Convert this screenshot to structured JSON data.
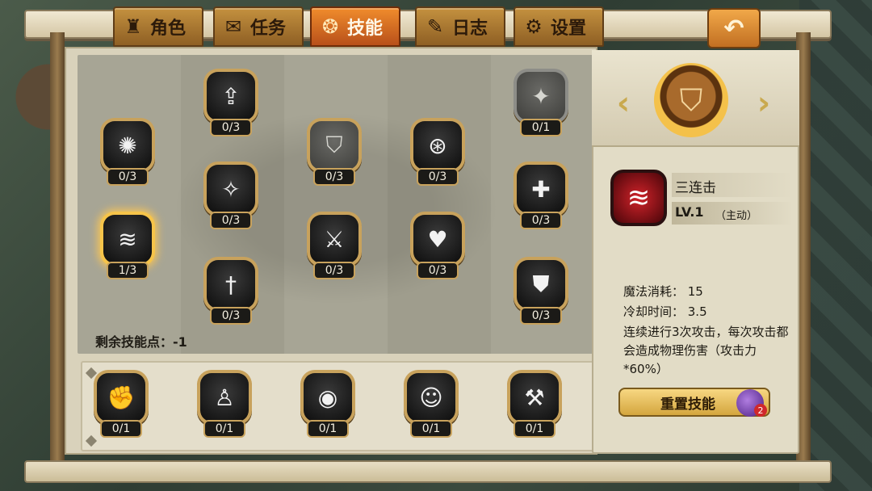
{
  "tabs": [
    {
      "label": "角色",
      "icon": "helmet-icon"
    },
    {
      "label": "任务",
      "icon": "scroll-icon"
    },
    {
      "label": "技能",
      "icon": "skill-scroll-icon",
      "active": true
    },
    {
      "label": "日志",
      "icon": "feather-icon"
    },
    {
      "label": "设置",
      "icon": "gear-icon"
    }
  ],
  "skill_tree": {
    "nodes": [
      {
        "id": "burst",
        "count": "0/3",
        "glyph": "✺",
        "icon": "burst-icon"
      },
      {
        "id": "spiral-up",
        "count": "0/3",
        "glyph": "⇪",
        "icon": "spiral-up-icon"
      },
      {
        "id": "shield-up",
        "count": "0/3",
        "glyph": "⛉",
        "icon": "shield-icon",
        "dim": true
      },
      {
        "id": "potion-swirl",
        "count": "0/3",
        "glyph": "⊛",
        "icon": "potion-swirl-icon"
      },
      {
        "id": "compass-star",
        "count": "0/1",
        "glyph": "✦",
        "icon": "compass-star-icon",
        "gray": true
      },
      {
        "id": "sword-up",
        "count": "0/3",
        "glyph": "✧",
        "icon": "sword-sparkle-icon"
      },
      {
        "id": "healing-wings",
        "count": "0/3",
        "glyph": "✚",
        "icon": "healing-wings-icon"
      },
      {
        "id": "triple-strike-small",
        "count": "1/3",
        "glyph": "≋",
        "icon": "slash-icon",
        "selected": true
      },
      {
        "id": "sword-shield",
        "count": "0/3",
        "glyph": "⚔",
        "icon": "sword-shield-icon"
      },
      {
        "id": "potion-heart",
        "count": "0/3",
        "glyph": "♥",
        "icon": "potion-heart-icon"
      },
      {
        "id": "sword-down",
        "count": "0/3",
        "glyph": "†",
        "icon": "sword-icon"
      },
      {
        "id": "guard-shield",
        "count": "0/3",
        "glyph": "⛊",
        "icon": "guard-shield-icon"
      }
    ],
    "remaining_points": "剩余技能点：-1"
  },
  "bottom_skills": [
    {
      "count": "0/1",
      "glyph": "✊",
      "icon": "fist-sparkle-icon"
    },
    {
      "count": "0/1",
      "glyph": "♙",
      "icon": "figure-pillar-icon"
    },
    {
      "count": "0/1",
      "glyph": "◉",
      "icon": "eye-icon"
    },
    {
      "count": "0/1",
      "glyph": "☺",
      "icon": "halo-figure-icon"
    },
    {
      "count": "0/1",
      "glyph": "⚒",
      "icon": "claw-icon"
    }
  ],
  "detail": {
    "emblem_icon": "shield-emblem-icon",
    "skill_name": "三连击",
    "level": "LV.1",
    "type": "（主动）",
    "mana_cost": "魔法消耗：  15",
    "cooldown": "冷却时间：  3.5",
    "description": "连续进行3次攻击，每次攻击都会造成物理伤害（攻击力*60%）",
    "reset_label": "重置技能",
    "reset_cost": "2"
  }
}
